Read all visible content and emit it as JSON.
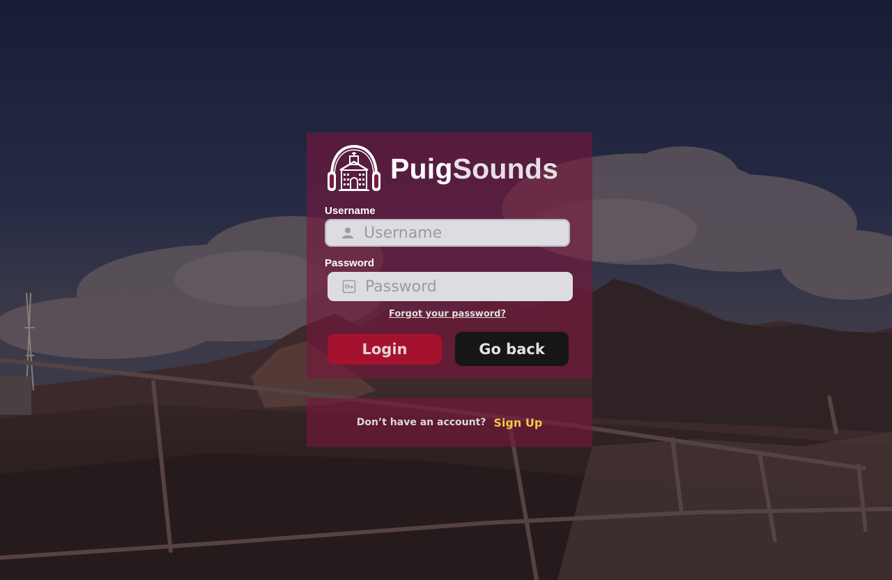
{
  "brand": {
    "name_part1": "Puig",
    "name_part2": "Sounds",
    "logo_icon": "headphones-chapel-icon"
  },
  "form": {
    "username_label": "Username",
    "username_placeholder": "Username",
    "username_icon": "user-icon",
    "password_label": "Password",
    "password_placeholder": "Password",
    "password_icon": "key-icon",
    "forgot_link": "Forgot your password?",
    "login_button": "Login",
    "back_button": "Go back"
  },
  "signup": {
    "question": "Don’t have an account?",
    "link": "Sign Up"
  },
  "colors": {
    "card_bg": "#78163c",
    "login_button": "#a5122e",
    "back_button": "#161616",
    "signup_link": "#f4c842"
  }
}
